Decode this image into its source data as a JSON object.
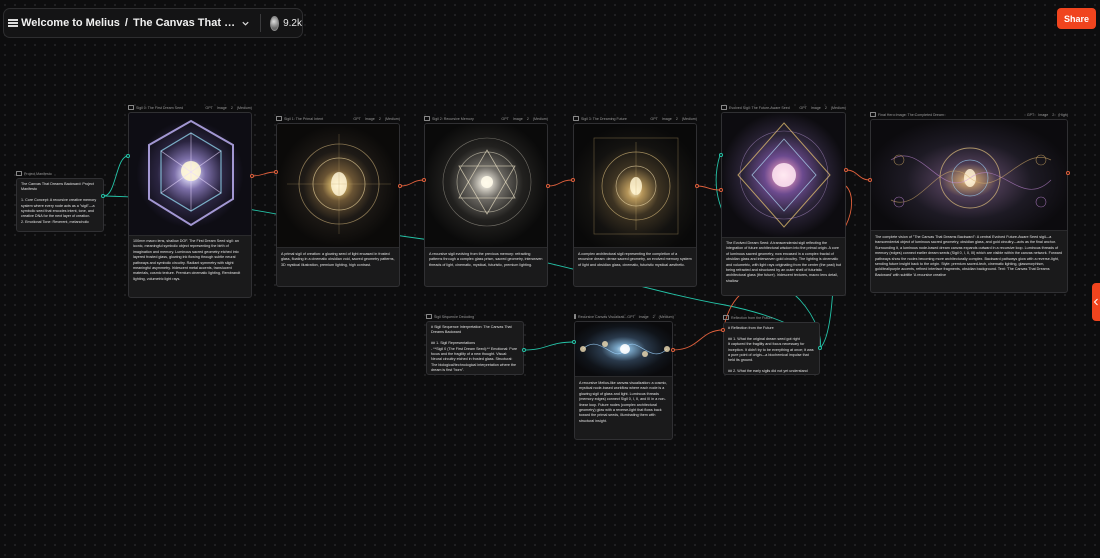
{
  "header": {
    "breadcrumb_root": "Welcome to Melius",
    "separator": "/",
    "project_title": "The Canvas That Dreams Backward",
    "views": "9.2k"
  },
  "actions": {
    "share_label": "Share"
  },
  "colors": {
    "accent": "#f0441e",
    "edge_green": "#24c4a8",
    "edge_orange": "#e0603c"
  },
  "nodes": {
    "manifesto": {
      "title": "Project Manifesto",
      "text": "The Canvas That Dreams Backward: Project Manifesto\n\n1. Core Concept: A recursive creative memory system where every node acts as a \"sigil\"—a symbolic seed that encodes intent, tone, and creative DNA for the next layer of creation.\n2. Emotional Tone: Reverent, melancholic"
    },
    "sigil0": {
      "title": "Sigil 0: The First Dream Seed",
      "model": "GPT",
      "kind": "Image",
      "count": "2",
      "quality": "(Medium)",
      "text": "100mm macro lens, shallow DOF. The First Dream Seed sigil: an iconic, meaningful symbolic object representing the birth of imagination and memory. Luminous sacred geometry etched into layered frosted glass, glowing ink flowing through subtle neural pathways and symbolic circuitry. Radiant symmetry with slight meaningful asymmetry. Iridescent metal accents, translucent materials, cosmic texture. Premium cinematic lighting, Rembrandt lighting, volumetric light rays."
    },
    "sigil1": {
      "title": "Sigil 1: The Primal Intent",
      "model": "GPT",
      "kind": "Image",
      "count": "2",
      "quality": "(Medium)",
      "text": "A primal sigil of creation: a glowing seed of light encased in frosted glass, floating in a cinematic obsidian void, sacred geometry patterns, 3D mystical illustration, premium lighting, high contrast."
    },
    "sigil2": {
      "title": "Sigil 2: Recursive Memory",
      "model": "GPT",
      "kind": "Image",
      "count": "2",
      "quality": "(Medium)",
      "text": "A recursive sigil evolving from the previous memory: refracting patterns through a complex glass prism, sacred geometry, interwoven threads of light, cinematic, mystical, futuristic, premium lighting."
    },
    "sigil3": {
      "title": "Sigil 3: The Dreaming Future",
      "model": "GPT",
      "kind": "Image",
      "count": "2",
      "quality": "(Medium)",
      "text": "A complex architectural sigil representing the completion of a recursive dream: dense sacred geometry, an evolved memory system of light and obsidian glass, cinematic, futuristic mystical aesthetic."
    },
    "evolved": {
      "title": "Evolved Sigil: The Future-Aware Seed",
      "model": "GPT",
      "kind": "Image",
      "count": "2",
      "quality": "(Medium)",
      "text": "The Evolved Dream Seed: A transcendental sigil reflecting the integration of future architectural wisdom into the primal origin. A core of luminous sacred geometry, now encased in a complex fractal of obsidian glass and interwoven gold circuitry. The lighting is cinematic and volumetric, with light rays originating from the center (the past) but being refracted and structured by an outer shell of futuristic architectural glass (the future). Iridescent textures, macro lens detail, shallow"
    },
    "final": {
      "title": "Final Hero Image: The Completed Dream",
      "model": "GPT",
      "kind": "Image",
      "count": "2",
      "quality": "(High)",
      "text": "The complete vision of \"The Canvas That Dreams Backward\": A central Evolved Future-Aware Seed sigil—a transcendental object of luminous sacred geometry, obsidian glass, and gold circuitry—acts as the final anchor. Surrounding it, a luminous node-based dream canvas expands outward in a recursive loop. Luminous threads of memory (edges) connect earlier dream seeds (Sigil 0, I, II, III) which are visible within the canvas network. Forward pathways show the nodes becoming more architecturally complex. Backward pathways glow with a reverse-light, sending future insight back to the origin. Style: premium sacred-tech, cinematic lighting, glassmorphism, gold/teal/purple accents, refined interface fragments, obsidian background. Text: 'The Canvas That Dreams Backward' with subtitle 'A recursive creative"
    },
    "decoding": {
      "title": "Sigil Sequence Decoding",
      "text": "# Sigil Sequence Interpretation: The Canvas That Dreams Backward\n\n## 1. Sigil Representations\n- **Sigil 0 (The First Dream Seed):** Emotional: Pure focus and the fragility of a new thought. Visual: Neural circuitry etched in frosted glass. Structural: The biological/technological interpretation where the dream is first \"born\"."
    },
    "recursive": {
      "title": "Recursive Canvas Visualizati...",
      "model": "GPT",
      "kind": "Image",
      "count": "2",
      "quality": "(Medium)",
      "text": "A recursive Melius-like canvas visualization: a cosmic, mystical node-based workflow where each node is a glowing sigil of glass and light. Luminous threads (memory edges) connect Sigil 0, I, II, and III in a non-linear loop. Future nodes (complex architectural geometry) glow with a reverse-light that flows back toward the primal seeds, illuminating them with structural insight."
    },
    "reflection": {
      "title": "Reflection from the Future",
      "text": "# Reflection from the Future\n\n## 1. What the original dream seed got right\nIt captured the fragility and focus necessary for inception. It didn't try to be everything at once; it was a pure point of origin—a biochemical impulse that held its ground.\n\n## 2. What the early sigils did not yet understand"
    }
  }
}
